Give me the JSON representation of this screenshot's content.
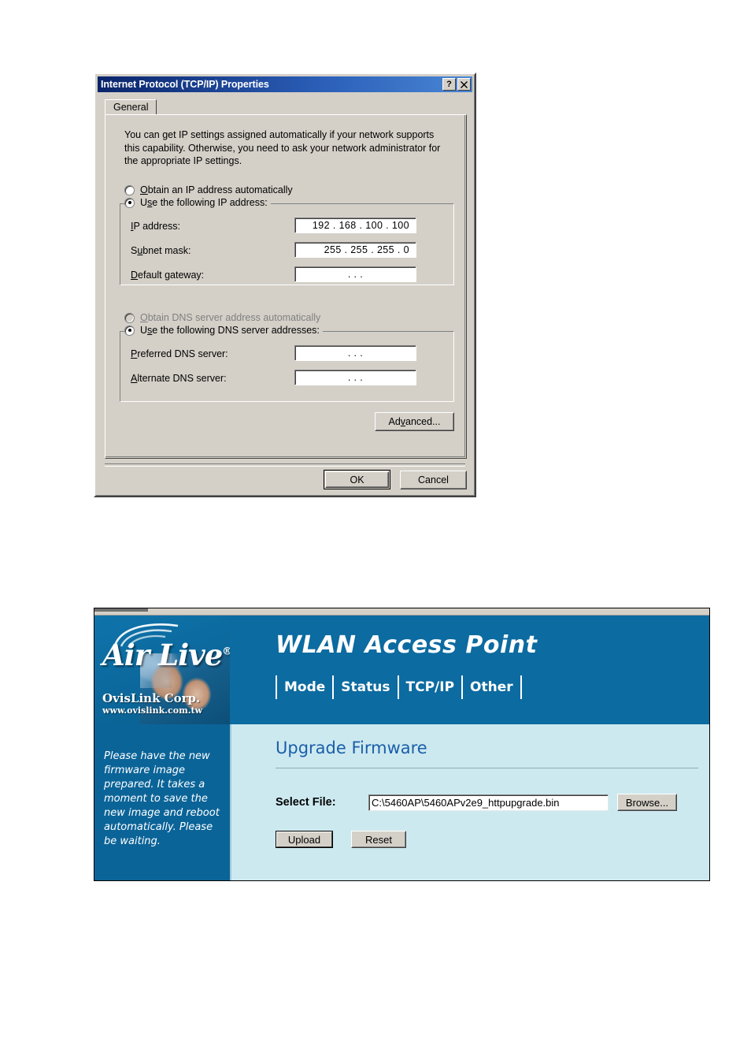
{
  "dialog": {
    "title": "Internet Protocol (TCP/IP) Properties",
    "help_button": "?",
    "close_button": "✕",
    "tabs": [
      {
        "label": "General"
      }
    ],
    "description": "You can get IP settings assigned automatically if your network supports this capability. Otherwise, you need to ask your network administrator for the appropriate IP settings.",
    "ip_mode": {
      "auto_label_pre": "",
      "auto_label_u": "O",
      "auto_label_post": "btain an IP address automatically",
      "auto_selected": false,
      "manual_label_pre": "U",
      "manual_label_u": "s",
      "manual_label_post": "e the following IP address:",
      "manual_selected": true
    },
    "ip_fields": [
      {
        "label_pre": "",
        "label_u": "I",
        "label_post": "P address:",
        "value": "192 . 168 . 100 . 100"
      },
      {
        "label_pre": "S",
        "label_u": "u",
        "label_post": "bnet mask:",
        "value": "255 . 255 . 255 .   0"
      },
      {
        "label_pre": "",
        "label_u": "D",
        "label_post": "efault gateway:",
        "value": ".        .        ."
      }
    ],
    "dns_mode": {
      "auto_label_pre": "",
      "auto_label_u": "O",
      "auto_label_post": "btain DNS server address automatically",
      "auto_selected": false,
      "auto_disabled": true,
      "manual_label_pre": "U",
      "manual_label_u": "s",
      "manual_label_post": "e the following DNS server addresses:",
      "manual_selected": true
    },
    "dns_fields": [
      {
        "label_pre": "",
        "label_u": "P",
        "label_post": "referred DNS server:",
        "value": ".        .        ."
      },
      {
        "label_pre": "",
        "label_u": "A",
        "label_post": "lternate DNS server:",
        "value": ".        .        ."
      }
    ],
    "advanced_button": {
      "pre": "Ad",
      "u": "v",
      "post": "anced..."
    },
    "ok_button": "OK",
    "cancel_button": "Cancel"
  },
  "router": {
    "brand": {
      "name": "Air Live",
      "registered": "®",
      "company": "OvisLink Corp.",
      "website": "www.ovislink.com.tw"
    },
    "header": {
      "title": "WLAN Access Point",
      "tabs": [
        {
          "label": "Mode"
        },
        {
          "label": "Status"
        },
        {
          "label": "TCP/IP"
        },
        {
          "label": "Other"
        }
      ]
    },
    "sidebar": {
      "note": "Please have the new firmware image prepared. It takes a moment to save the new image and reboot automatically. Please be waiting."
    },
    "content": {
      "page_title": "Upgrade Firmware",
      "select_file_label": "Select File:",
      "file_value": "C:\\5460AP\\5460APv2e9_httpupgrade.bin",
      "browse_button": "Browse...",
      "upload_button": "Upload",
      "reset_button": "Reset"
    }
  },
  "colors": {
    "header_blue": "#0c6ba0",
    "sidebar_blue": "#0b6498",
    "content_cyan": "#cde9f0",
    "page_title_blue": "#1a5fa8",
    "dialog_face": "#d4d0c8",
    "titlebar_navy": "#0a246a"
  }
}
